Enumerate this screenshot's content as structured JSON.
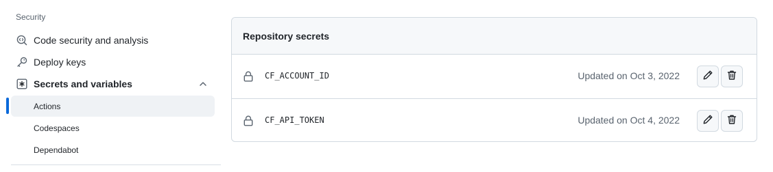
{
  "sidebar": {
    "section_title": "Security",
    "items": [
      {
        "label": "Code security and analysis",
        "icon": "codescan-icon"
      },
      {
        "label": "Deploy keys",
        "icon": "key-icon"
      },
      {
        "label": "Secrets and variables",
        "icon": "asterisk-square-icon",
        "expanded": true
      }
    ],
    "sub_items": [
      {
        "label": "Actions",
        "active": true
      },
      {
        "label": "Codespaces",
        "active": false
      },
      {
        "label": "Dependabot",
        "active": false
      }
    ]
  },
  "secrets": {
    "header": "Repository secrets",
    "rows": [
      {
        "name": "CF_ACCOUNT_ID",
        "updated": "Updated on Oct 3, 2022"
      },
      {
        "name": "CF_API_TOKEN",
        "updated": "Updated on Oct 4, 2022"
      }
    ]
  },
  "colors": {
    "accent": "#0969da",
    "border": "#d1d9e0",
    "muted_text": "#59636e"
  }
}
